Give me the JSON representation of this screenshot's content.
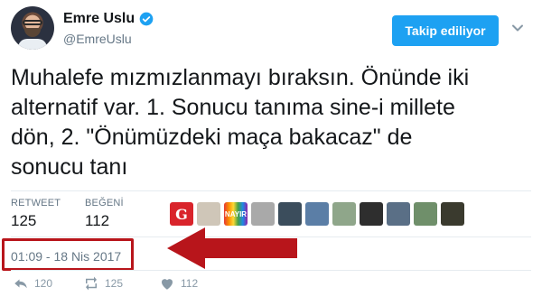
{
  "user": {
    "name": "Emre Uslu",
    "handle": "@EmreUslu",
    "verified": true
  },
  "follow_button": {
    "label": "Takip ediliyor",
    "color": "#1da1f2"
  },
  "tweet": {
    "lines": [
      "Muhalefe mızmızlanmayı bıraksın. Önünde iki",
      "alternatif var. 1. Sonucu tanıma sine-i millete",
      "dön, 2. \"Önümüzdeki maça bakacaz\" de",
      "sonucu tanı"
    ]
  },
  "stats": {
    "retweets": {
      "label": "RETWEET",
      "value": "125"
    },
    "likes": {
      "label": "BEĞENİ",
      "value": "112"
    }
  },
  "likers": [
    {
      "icon": "g-logo",
      "text": "G",
      "bg": "#d9242b"
    },
    {
      "icon": "document-thumb",
      "text": "",
      "bg": "#cfc6b8"
    },
    {
      "icon": "rainbow-nayir",
      "text": "NAYIR",
      "bg": "#7b3fa0"
    },
    {
      "icon": "avatar-thumb",
      "text": "",
      "bg": "#a9a9a9"
    },
    {
      "icon": "avatar-thumb",
      "text": "",
      "bg": "#3b4d5c"
    },
    {
      "icon": "popeye-thumb",
      "text": "",
      "bg": "#5b7ea6"
    },
    {
      "icon": "avatar-thumb",
      "text": "",
      "bg": "#8fa68a"
    },
    {
      "icon": "avatar-thumb",
      "text": "",
      "bg": "#2e2e2e"
    },
    {
      "icon": "avatar-thumb",
      "text": "",
      "bg": "#5a6f86"
    },
    {
      "icon": "avatar-thumb",
      "text": "",
      "bg": "#6f8f6a"
    },
    {
      "icon": "avatar-thumb",
      "text": "",
      "bg": "#3a3a2e"
    }
  ],
  "timestamp": "01:09 - 18 Nis 2017",
  "highlight_color": "#b8151b",
  "actions": {
    "reply": {
      "icon": "reply-icon",
      "count": "120"
    },
    "retweet": {
      "icon": "retweet-icon",
      "count": "125"
    },
    "like": {
      "icon": "heart-icon",
      "count": "112"
    }
  }
}
